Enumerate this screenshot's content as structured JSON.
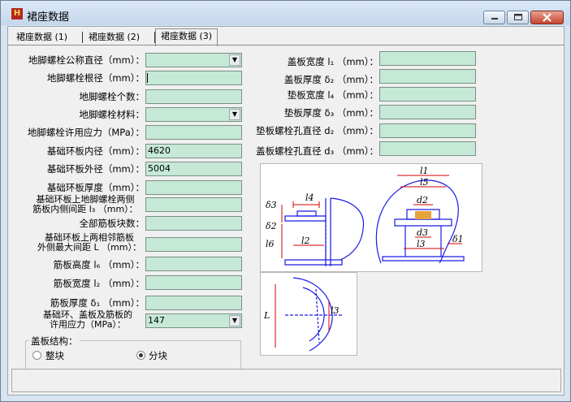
{
  "window": {
    "title": "裙座数据",
    "app_icon_text": "H",
    "buttons": {
      "minimize": "minimize",
      "maximize": "maximize",
      "close": "close"
    }
  },
  "tabs": [
    {
      "label": "裙座数据 (1)",
      "active": false
    },
    {
      "label": "裙座数据 (2)",
      "active": false
    },
    {
      "label": "裙座数据 (3)",
      "active": true
    }
  ],
  "left_form": {
    "bolt_nominal_diameter": {
      "label": "地脚螺栓公称直径（mm）：",
      "value": ""
    },
    "bolt_root_diameter": {
      "label": "地脚螺栓根径（mm）：",
      "value": ""
    },
    "bolt_count": {
      "label": "地脚螺栓个数：",
      "value": ""
    },
    "bolt_material": {
      "label": "地脚螺栓材料：",
      "value": ""
    },
    "bolt_allowable_stress": {
      "label": "地脚螺栓许用应力（MPa）：",
      "value": ""
    },
    "base_ring_inner_diameter": {
      "label": "基础环板内径（mm）：",
      "value": "4620"
    },
    "base_ring_outer_diameter": {
      "label": "基础环板外径（mm）：",
      "value": "5004"
    },
    "base_ring_thickness": {
      "label": "基础环板厚度（mm）：",
      "value": ""
    },
    "rib_inner_spacing": {
      "label_line1": "基础环板上地脚螺栓两侧",
      "label_line2": "筋板内侧间距 l₃ （mm）：",
      "value": ""
    },
    "total_rib_count": {
      "label": "全部筋板块数：",
      "value": ""
    },
    "rib_outer_spacing": {
      "label_line1": "基础环板上两相邻筋板",
      "label_line2": "外侧最大间距 L （mm）：",
      "value": ""
    },
    "rib_height": {
      "label": "筋板高度 l₆ （mm）：",
      "value": ""
    },
    "rib_width": {
      "label": "筋板宽度 l₂ （mm）：",
      "value": ""
    },
    "rib_thickness": {
      "label": "筋板厚度 δ₁ （mm）：",
      "value": ""
    },
    "allowable_stress": {
      "label_line1": "基础环、盖板及筋板的",
      "label_line2": "许用应力（MPa）：",
      "value": "147"
    }
  },
  "right_form": {
    "cover_width": {
      "label": "盖板宽度 l₁ （mm）：",
      "value": ""
    },
    "cover_thickness": {
      "label": "盖板厚度 δ₂ （mm）：",
      "value": ""
    },
    "pad_width": {
      "label": "垫板宽度 l₄ （mm）：",
      "value": ""
    },
    "pad_thickness": {
      "label": "垫板厚度 δ₃ （mm）：",
      "value": ""
    },
    "pad_hole_diameter": {
      "label": "垫板螺栓孔直径 d₂ （mm）：",
      "value": ""
    },
    "cover_hole_diameter": {
      "label": "盖板螺栓孔直径 d₃ （mm）：",
      "value": ""
    }
  },
  "cover_structure": {
    "group_label": "盖板结构：",
    "options": [
      {
        "label": "整块",
        "selected": false
      },
      {
        "label": "分块",
        "selected": true
      }
    ]
  },
  "diagram_labels": {
    "l1": "l1",
    "l2": "l2",
    "l3": "l3",
    "l4": "l4",
    "l5": "l5",
    "l6": "l6",
    "d1": "δ1",
    "d2": "δ2",
    "d3": "δ3",
    "dd2": "d2",
    "dd3": "d3",
    "L": "L"
  },
  "colors": {
    "field_bg": "#c6e9d7",
    "diagram_line": "#1a1ae6",
    "diagram_dim": "#d10000"
  }
}
